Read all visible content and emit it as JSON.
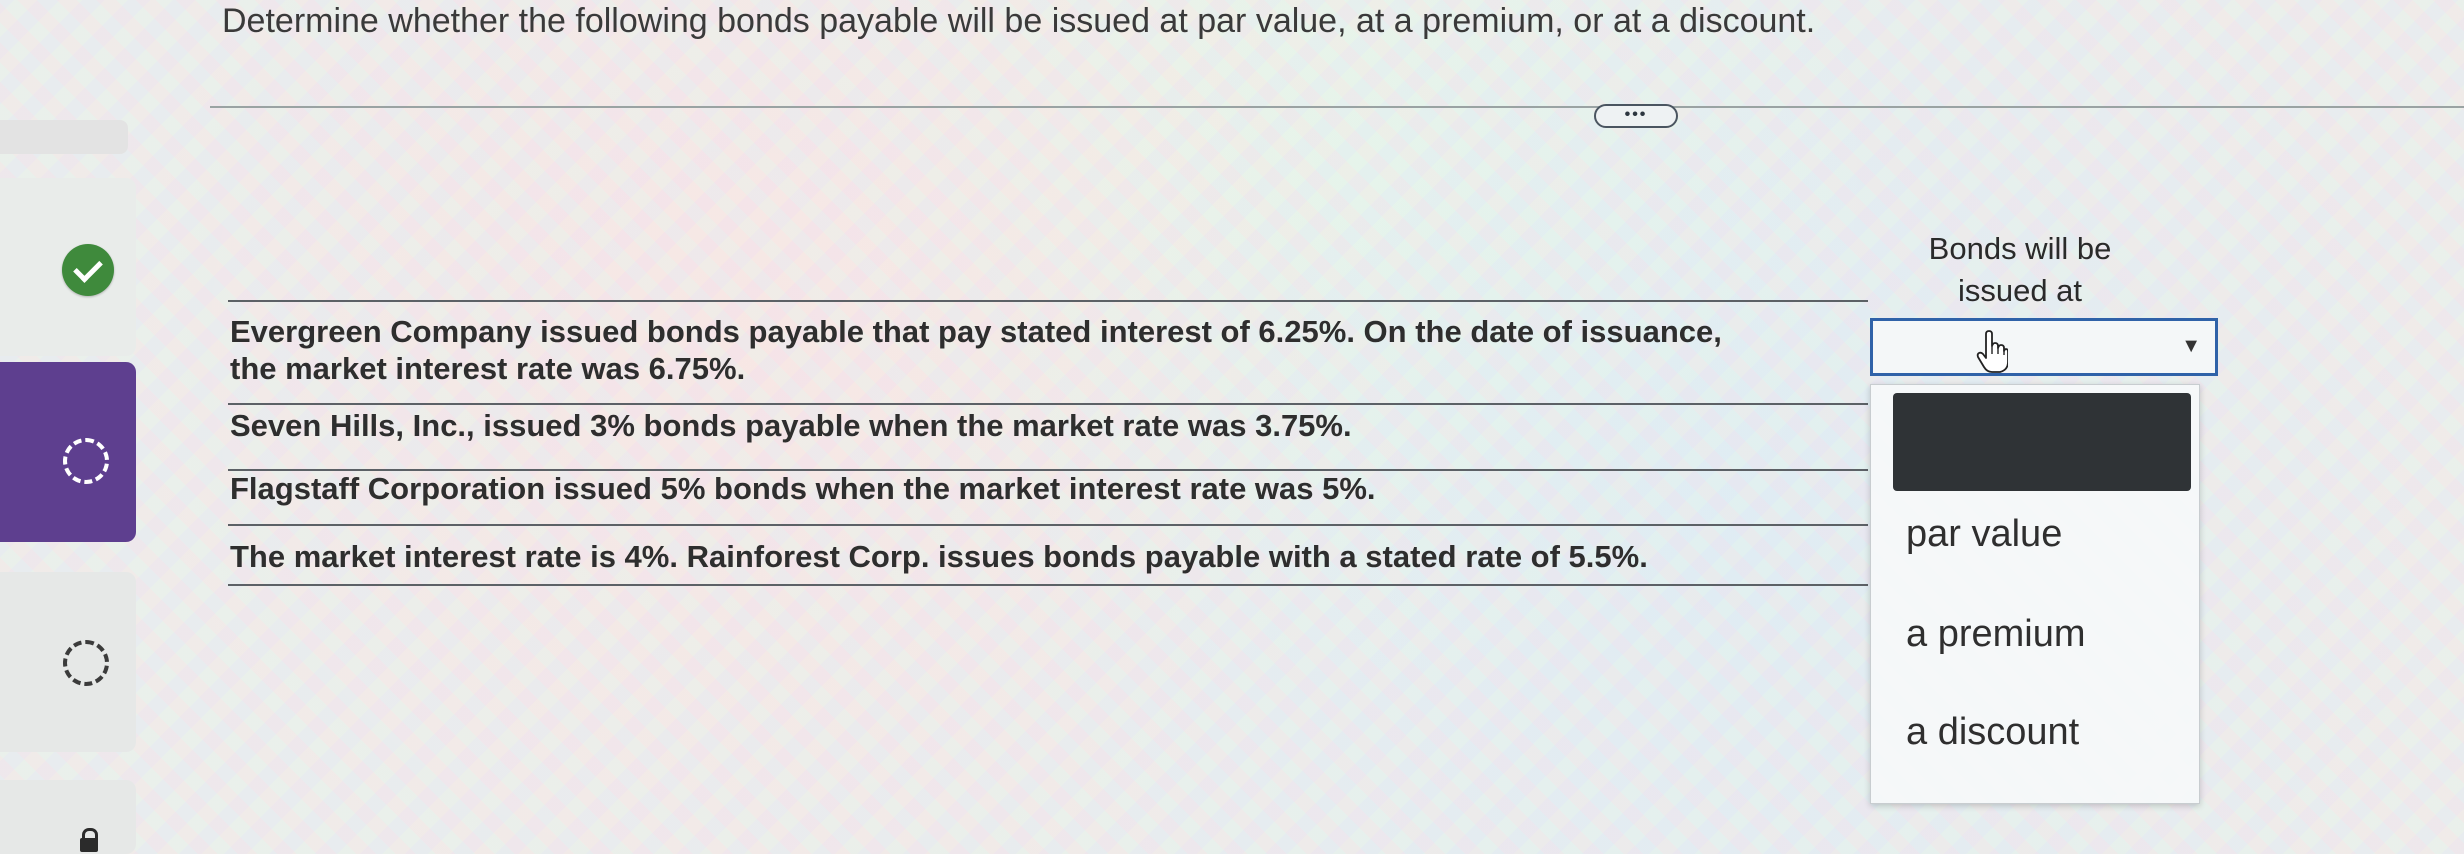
{
  "instructions": "Determine whether the following bonds payable will be issued at par value, at a premium, or at a discount.",
  "more_button": "•••",
  "table": {
    "column_header_line1": "Bonds will be",
    "column_header_line2": "issued at",
    "rows": [
      {
        "line1": "Evergreen Company issued bonds payable that pay stated interest of 6.25%. On the date of issuance,",
        "line2": "the market interest rate was 6.75%."
      },
      {
        "line1": "Seven Hills, Inc., issued 3% bonds payable when the market rate was 3.75%."
      },
      {
        "line1": "Flagstaff Corporation issued 5% bonds when the market interest rate was 5%."
      },
      {
        "line1": "The market interest rate is 4%. Rainforest Corp. issues bonds payable with a stated rate of 5.5%."
      }
    ]
  },
  "dropdown": {
    "selected": "",
    "arrow": "▼",
    "options": [
      "",
      "par value",
      "a premium",
      "a discount"
    ]
  },
  "sidebar": {
    "items": [
      {
        "status": "complete",
        "icon": "check-circle-icon"
      },
      {
        "status": "current",
        "icon": "dashed-circle-icon"
      },
      {
        "status": "incomplete",
        "icon": "dashed-circle-icon"
      },
      {
        "status": "locked",
        "icon": "lock-icon"
      }
    ]
  },
  "colors": {
    "active_card": "#5e3f8f",
    "complete_check": "#3f8a3c",
    "select_border": "#2f62a8"
  }
}
